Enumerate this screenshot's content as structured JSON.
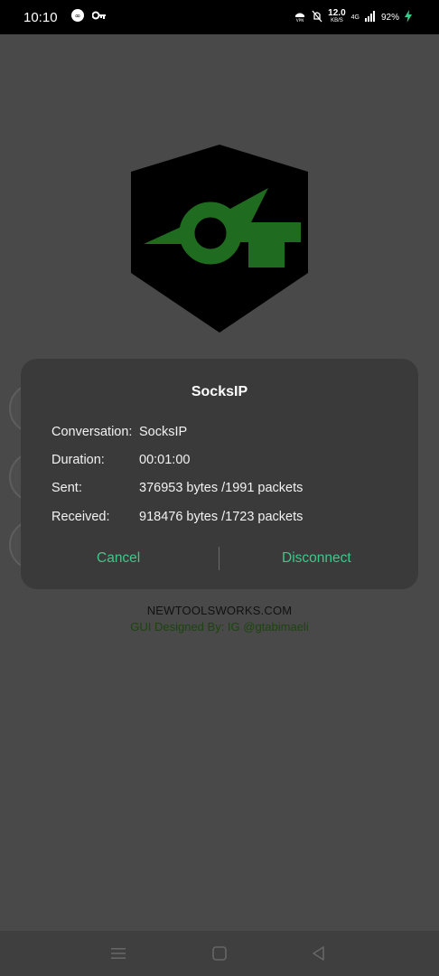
{
  "status_bar": {
    "time": "10:10",
    "speed_value": "12.0",
    "speed_unit": "KB/S",
    "network": "4G",
    "battery": "92%",
    "icons": [
      "chat-icon",
      "key-icon",
      "vpn-icon",
      "mute-icon",
      "signal-icon",
      "battery-charging-icon"
    ]
  },
  "dialog": {
    "title": "SocksIP",
    "rows": [
      {
        "label": "Conversation:",
        "value": "SocksIP"
      },
      {
        "label": "Duration:",
        "value": "00:01:00"
      },
      {
        "label": "Sent:",
        "value": "376953 bytes /1991 packets"
      },
      {
        "label": "Received:",
        "value": "918476 bytes /1723 packets"
      }
    ],
    "cancel_label": "Cancel",
    "disconnect_label": "Disconnect"
  },
  "credits": {
    "site": "NEWTOOLSWORKS.COM",
    "designer": "GUI  Designed By: IG @gtabimaeli"
  },
  "colors": {
    "accent": "#3ec88a",
    "logo_green": "#1f6b1f",
    "logo_bg": "#000000",
    "dialog_bg": "#3a3a3a"
  }
}
